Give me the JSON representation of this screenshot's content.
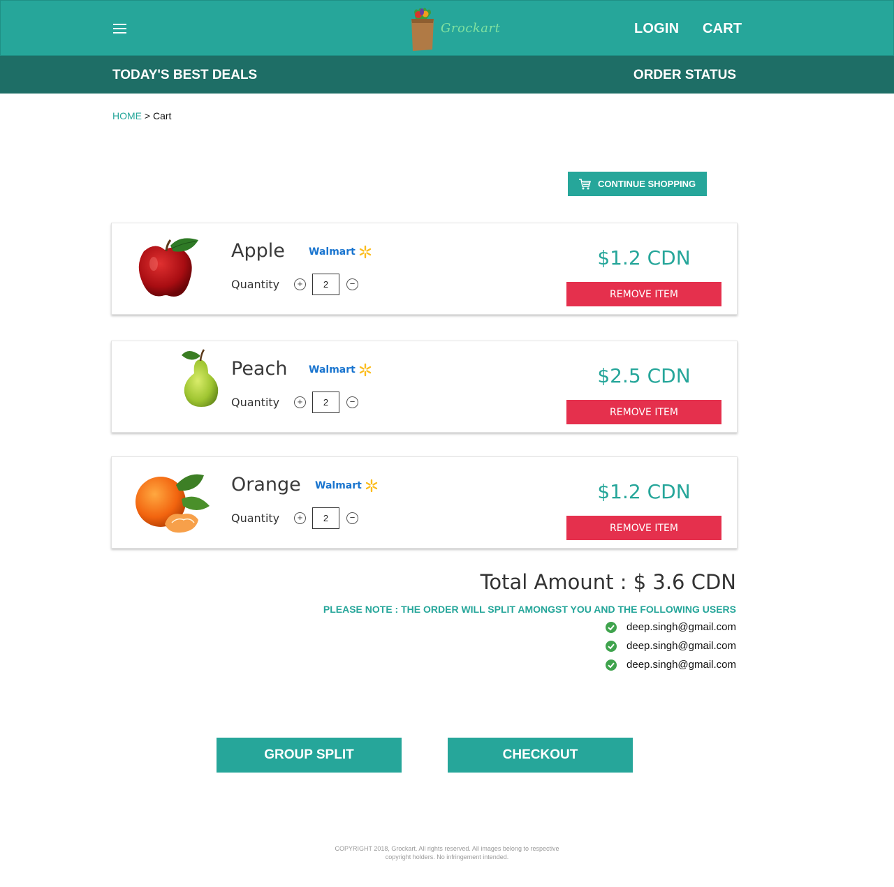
{
  "header": {
    "logo_text": "Grockart",
    "login_label": "LOGIN",
    "cart_label": "CART",
    "menu_icon": "hamburger-menu-icon"
  },
  "subnav": {
    "deals_label": "TODAY'S BEST DEALS",
    "order_status_label": "ORDER STATUS"
  },
  "breadcrumb": {
    "home": "HOME",
    "separator": ">",
    "current": "Cart"
  },
  "continue_shopping": {
    "label": "CONTINUE SHOPPING",
    "icon": "shopping-cart-icon"
  },
  "cart": {
    "quantity_label": "Quantity",
    "remove_label": "REMOVE ITEM",
    "store": "Walmart",
    "items": [
      {
        "name": "Apple",
        "quantity": "2",
        "price": "$1.2 CDN",
        "image": "apple-image"
      },
      {
        "name": "Peach",
        "quantity": "2",
        "price": "$2.5 CDN",
        "image": "pear-image"
      },
      {
        "name": "Orange",
        "quantity": "2",
        "price": "$1.2 CDN",
        "image": "orange-image"
      }
    ]
  },
  "summary": {
    "total": "Total Amount : $ 3.6 CDN",
    "note": "PLEASE NOTE : THE ORDER WILL SPLIT AMONGST YOU AND THE FOLLOWING  USERS",
    "users": [
      "deep.singh@gmail.com",
      "deep.singh@gmail.com",
      "deep.singh@gmail.com"
    ]
  },
  "actions": {
    "group_split": "GROUP SPLIT",
    "checkout": "CHECKOUT"
  },
  "footer": {
    "text": "COPYRIGHT 2018, Grockart. All rights reserved. All images belong to respective copyright holders. No infringement intended."
  },
  "colors": {
    "primary": "#26a69a",
    "primary_dark": "#1e6e66",
    "danger": "#e5304d",
    "walmart_blue": "#1a75cf",
    "walmart_spark": "#fbbc1d",
    "check_green": "#3fa34d"
  }
}
